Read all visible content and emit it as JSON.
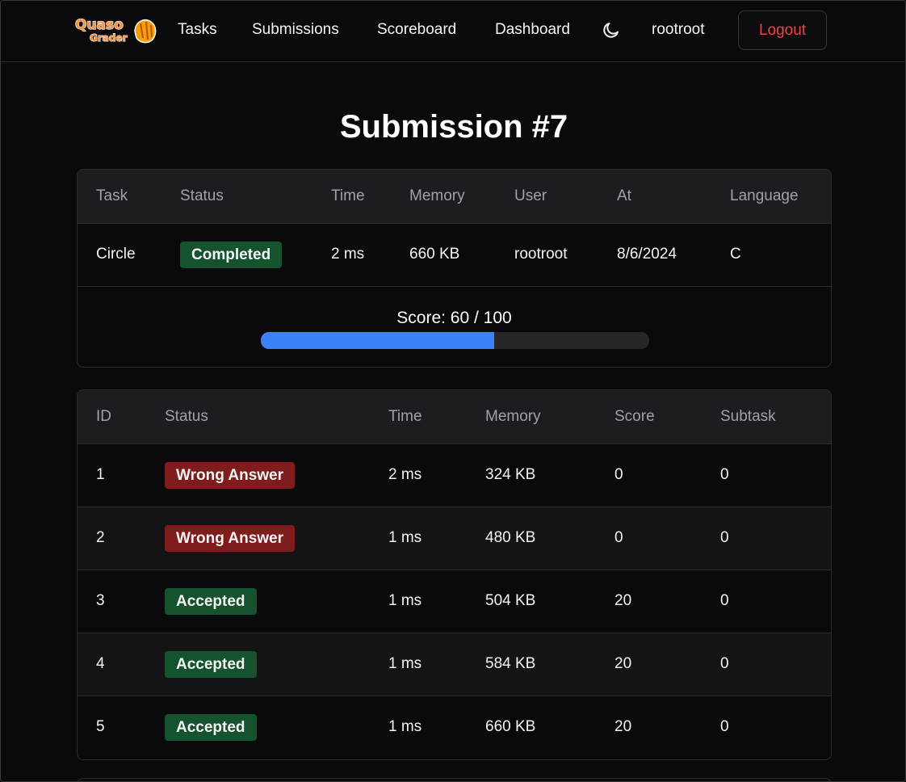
{
  "nav": {
    "logo_text_top": "Quaso",
    "logo_text_bottom": "Grader",
    "links": [
      "Tasks",
      "Submissions",
      "Scoreboard",
      "Dashboard"
    ],
    "theme_icon": "moon-icon",
    "username": "rootroot",
    "logout_label": "Logout",
    "logout_color": "#ef4444"
  },
  "page": {
    "title": "Submission #7"
  },
  "summary": {
    "headers": [
      "Task",
      "Status",
      "Time",
      "Memory",
      "User",
      "At",
      "Language"
    ],
    "row": {
      "task": "Circle",
      "status": "Completed",
      "time": "2 ms",
      "memory": "660 KB",
      "user": "rootroot",
      "at": "8/6/2024",
      "language": "C"
    },
    "score_label": "Score: 60 / 100",
    "score": 60,
    "score_max": 100,
    "progress_color": "#3b82f6"
  },
  "testcases": {
    "headers": [
      "ID",
      "Status",
      "Time",
      "Memory",
      "Score",
      "Subtask"
    ],
    "rows": [
      {
        "id": "1",
        "status": "Wrong Answer",
        "time": "2 ms",
        "memory": "324 KB",
        "score": "0",
        "subtask": "0"
      },
      {
        "id": "2",
        "status": "Wrong Answer",
        "time": "1 ms",
        "memory": "480 KB",
        "score": "0",
        "subtask": "0"
      },
      {
        "id": "3",
        "status": "Accepted",
        "time": "1 ms",
        "memory": "504 KB",
        "score": "20",
        "subtask": "0"
      },
      {
        "id": "4",
        "status": "Accepted",
        "time": "1 ms",
        "memory": "584 KB",
        "score": "20",
        "subtask": "0"
      },
      {
        "id": "5",
        "status": "Accepted",
        "time": "1 ms",
        "memory": "660 KB",
        "score": "20",
        "subtask": "0"
      }
    ]
  },
  "colors": {
    "accepted": "#14532d",
    "wrong_answer": "#7f1d1d"
  }
}
